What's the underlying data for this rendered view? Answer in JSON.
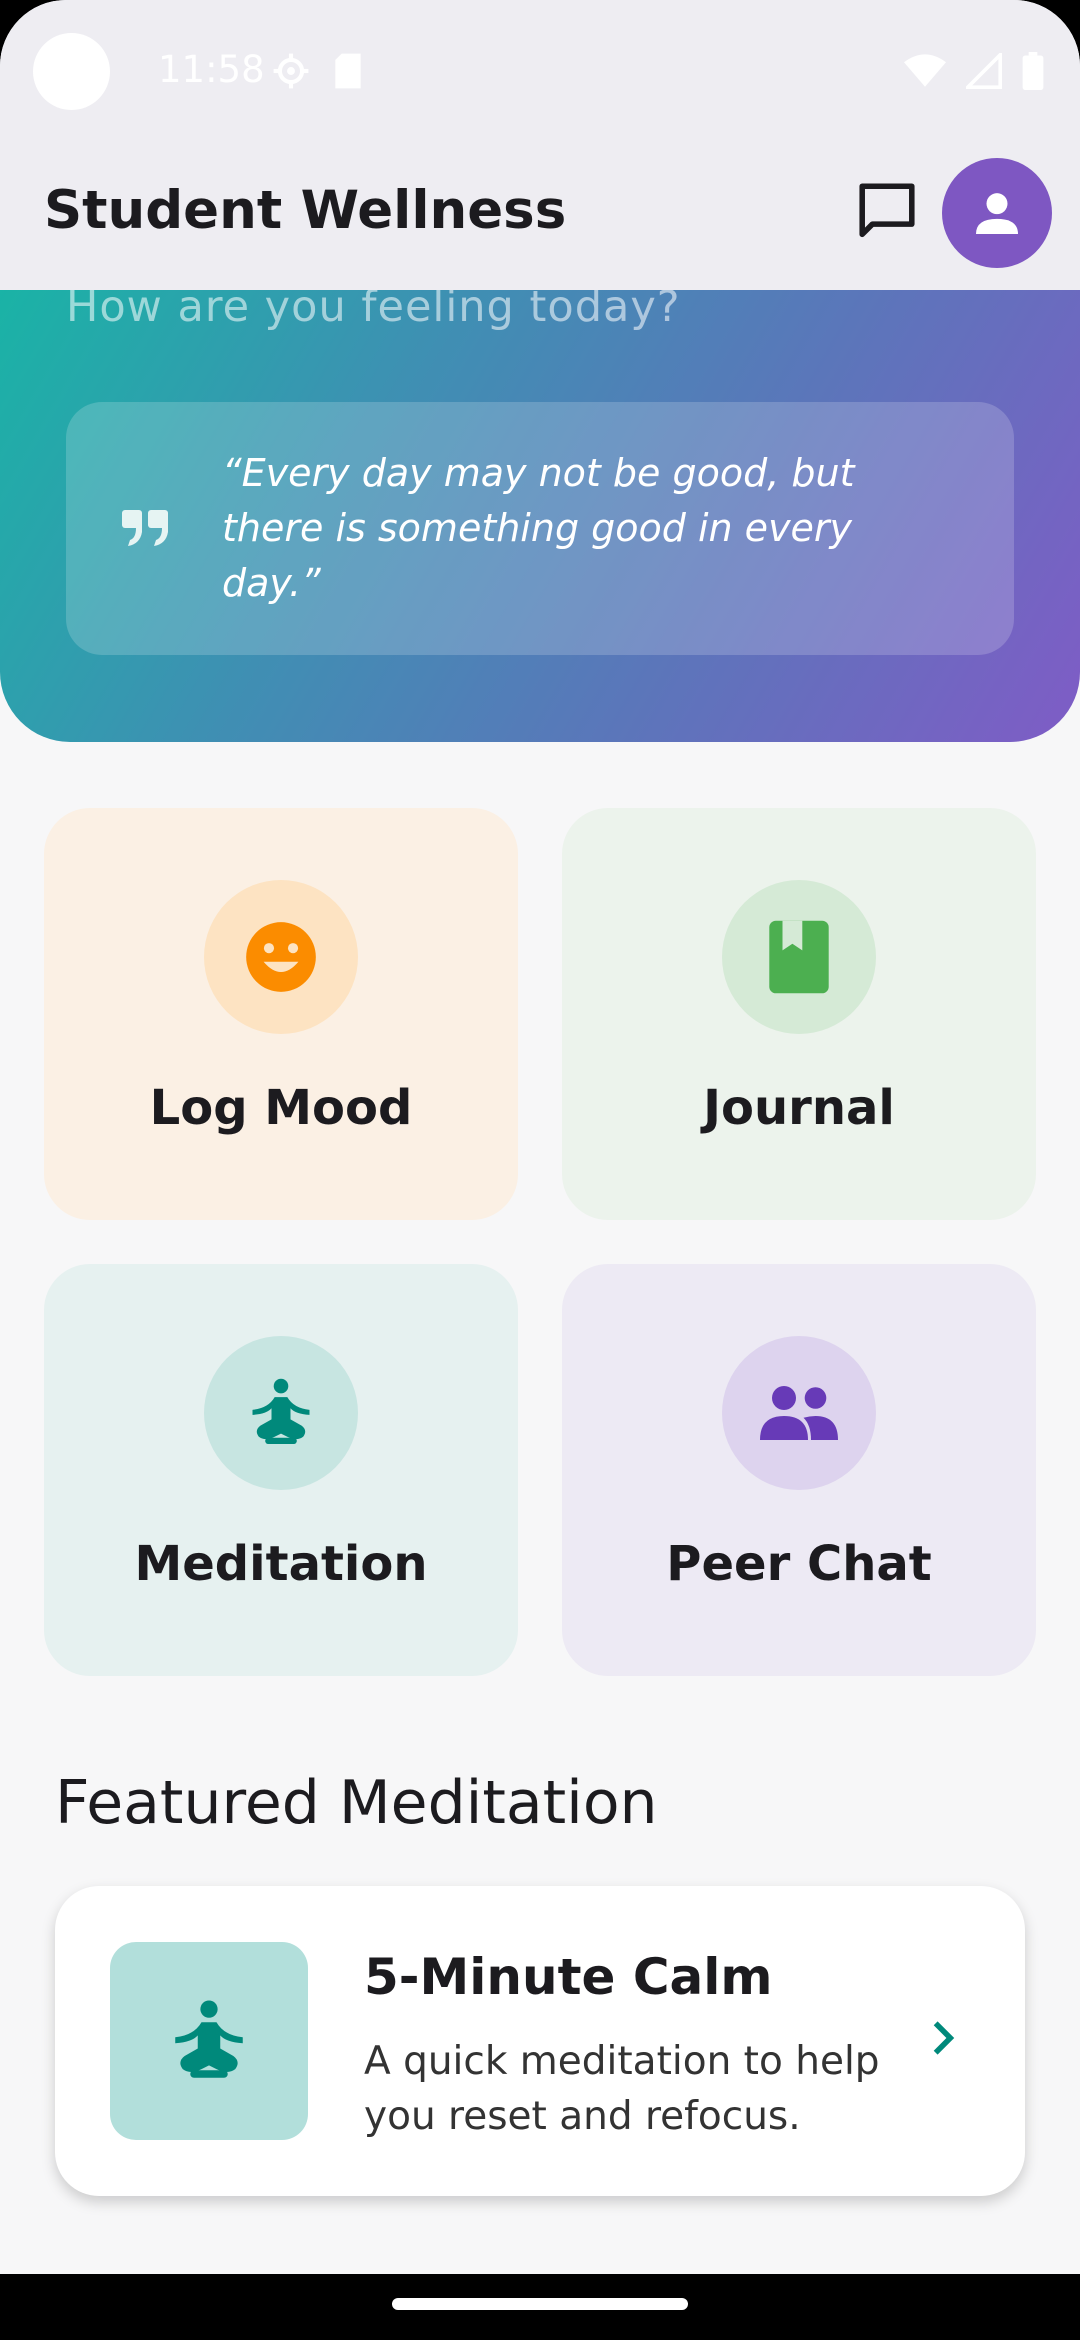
{
  "status_bar": {
    "time": "11:58",
    "icons": [
      "settings-icon",
      "sd-card-icon",
      "wifi-icon",
      "signal-icon",
      "battery-icon"
    ]
  },
  "app_bar": {
    "title": "Student Wellness",
    "icons": [
      "chat-icon",
      "person-icon"
    ]
  },
  "hero": {
    "greeting": "How are you feeling today?",
    "quote": "“Every day may not be good, but there is something good in every day.”"
  },
  "actions": [
    {
      "label": "Log Mood",
      "icon": "smile-icon",
      "bg": "#fbf0e4",
      "circle": "#fde3c2",
      "color": "#fb8c00"
    },
    {
      "label": "Journal",
      "icon": "book-icon",
      "bg": "#ecf3ec",
      "circle": "#d5ead6",
      "color": "#4caf50"
    },
    {
      "label": "Meditation",
      "icon": "meditation-icon",
      "bg": "#e6f1f0",
      "circle": "#c7e5e1",
      "color": "#00897b"
    },
    {
      "label": "Peer Chat",
      "icon": "people-icon",
      "bg": "#edeaf4",
      "circle": "#ddd3ee",
      "color": "#673ab7"
    }
  ],
  "featured": {
    "title": "Featured Meditation",
    "name": "5-Minute Calm",
    "description": "A quick meditation to help you reset and refocus.",
    "accent": "#00897b"
  }
}
